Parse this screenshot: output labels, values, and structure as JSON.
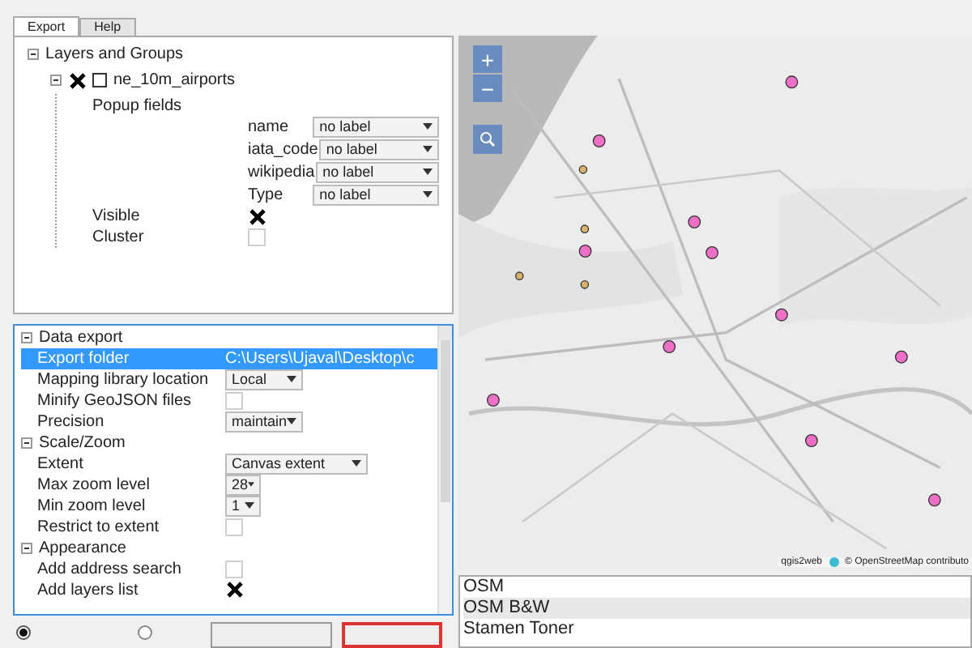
{
  "tabs": [
    {
      "label": "Export",
      "selected": true
    },
    {
      "label": "Help",
      "selected": false
    }
  ],
  "layers_tree": {
    "label": "Layers and Groups",
    "expanded": true,
    "layers": [
      {
        "name": "ne_10m_airports",
        "checked": true,
        "expanded": true,
        "popup_label": "Popup fields",
        "popup_fields": [
          {
            "field": "name",
            "value": "no label"
          },
          {
            "field": "iata_code",
            "value": "no label"
          },
          {
            "field": "wikipedia",
            "value": "no label"
          },
          {
            "field": "Type",
            "value": "no label"
          }
        ],
        "properties": [
          {
            "label": "Visible",
            "checked": true
          },
          {
            "label": "Cluster",
            "checked": false
          }
        ]
      }
    ]
  },
  "settings": [
    {
      "title": "Data export",
      "expanded": true,
      "items": [
        {
          "kind": "text",
          "label": "Export folder",
          "value": "C:\\Users\\Ujaval\\Desktop\\c",
          "selected": true
        },
        {
          "kind": "select",
          "label": "Mapping library location",
          "value": "Local",
          "selected": false
        },
        {
          "kind": "checkbox",
          "label": "Minify GeoJSON files",
          "checked": false,
          "selected": false
        },
        {
          "kind": "select",
          "label": "Precision",
          "value": "maintain",
          "selected": false
        }
      ]
    },
    {
      "title": "Scale/Zoom",
      "expanded": true,
      "items": [
        {
          "kind": "select",
          "label": "Extent",
          "value": "Canvas extent",
          "selected": false
        },
        {
          "kind": "select",
          "label": "Max zoom level",
          "value": "28",
          "selected": false
        },
        {
          "kind": "select",
          "label": "Min zoom level",
          "value": "1",
          "selected": false
        },
        {
          "kind": "checkbox",
          "label": "Restrict to extent",
          "checked": false,
          "selected": false
        }
      ]
    },
    {
      "title": "Appearance",
      "expanded": true,
      "items": [
        {
          "kind": "checkbox",
          "label": "Add address search",
          "checked": false,
          "selected": false
        },
        {
          "kind": "checkbox",
          "label": "Add layers list",
          "checked": true,
          "selected": false
        }
      ]
    }
  ],
  "map": {
    "zoom_in": "+",
    "zoom_out": "−",
    "attribution_app": "qgis2web",
    "attribution": "© OpenStreetMap contributo"
  },
  "preview_radios": [
    {
      "selected": true
    },
    {
      "selected": false
    }
  ],
  "basemaps": [
    {
      "name": "OSM",
      "selected": false
    },
    {
      "name": "OSM B&W",
      "selected": true
    },
    {
      "name": "Stamen Toner",
      "selected": false
    }
  ]
}
